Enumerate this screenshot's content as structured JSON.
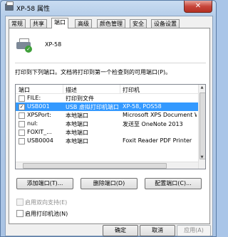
{
  "window": {
    "title": "XP-58 属性",
    "close_glyph": "✕"
  },
  "tabs": [
    {
      "label": "常规"
    },
    {
      "label": "共享"
    },
    {
      "label": "端口"
    },
    {
      "label": "高级"
    },
    {
      "label": "颜色管理"
    },
    {
      "label": "安全"
    },
    {
      "label": "设备设置"
    }
  ],
  "active_tab": "端口",
  "printer": {
    "name": "XP-58"
  },
  "ports": {
    "description": "打印到下列端口。文档将打印到第一个检查到的可用端口(P)。",
    "columns": {
      "port": "端口",
      "description": "描述",
      "printer": "打印机"
    },
    "rows": [
      {
        "port": "FILE:",
        "description": "打印到文件",
        "printer": "",
        "checked": false,
        "selected": false
      },
      {
        "port": "USB001",
        "description": "USB 虚拟打印机端口",
        "printer": "XP-58, POS58",
        "checked": true,
        "selected": true
      },
      {
        "port": "XPSPort:",
        "description": "本地端口",
        "printer": "Microsoft XPS Document W...",
        "checked": false,
        "selected": false
      },
      {
        "port": "nul:",
        "description": "本地端口",
        "printer": "发送至 OneNote 2013",
        "checked": false,
        "selected": false
      },
      {
        "port": "FOXIT_...",
        "description": "本地端口",
        "printer": "",
        "checked": false,
        "selected": false
      },
      {
        "port": "USB0004",
        "description": "本地端口",
        "printer": "Foxit Reader PDF Printer",
        "checked": false,
        "selected": false
      }
    ]
  },
  "actions": {
    "add_port": "添加端口(T)...",
    "delete_port": "删除端口(D)",
    "configure_port": "配置端口(C)..."
  },
  "options": {
    "bidirectional": {
      "label": "启用双向支持(E)",
      "checked": false,
      "enabled": false
    },
    "pooling": {
      "label": "启用打印机池(N)",
      "checked": false,
      "enabled": true
    }
  },
  "footer": {
    "ok": "确定",
    "cancel": "取消",
    "apply": "应用(A)"
  },
  "colors": {
    "selection": "#3399ff",
    "title_gradient_top": "#c9dcf1",
    "close_button": "#c7453a"
  }
}
